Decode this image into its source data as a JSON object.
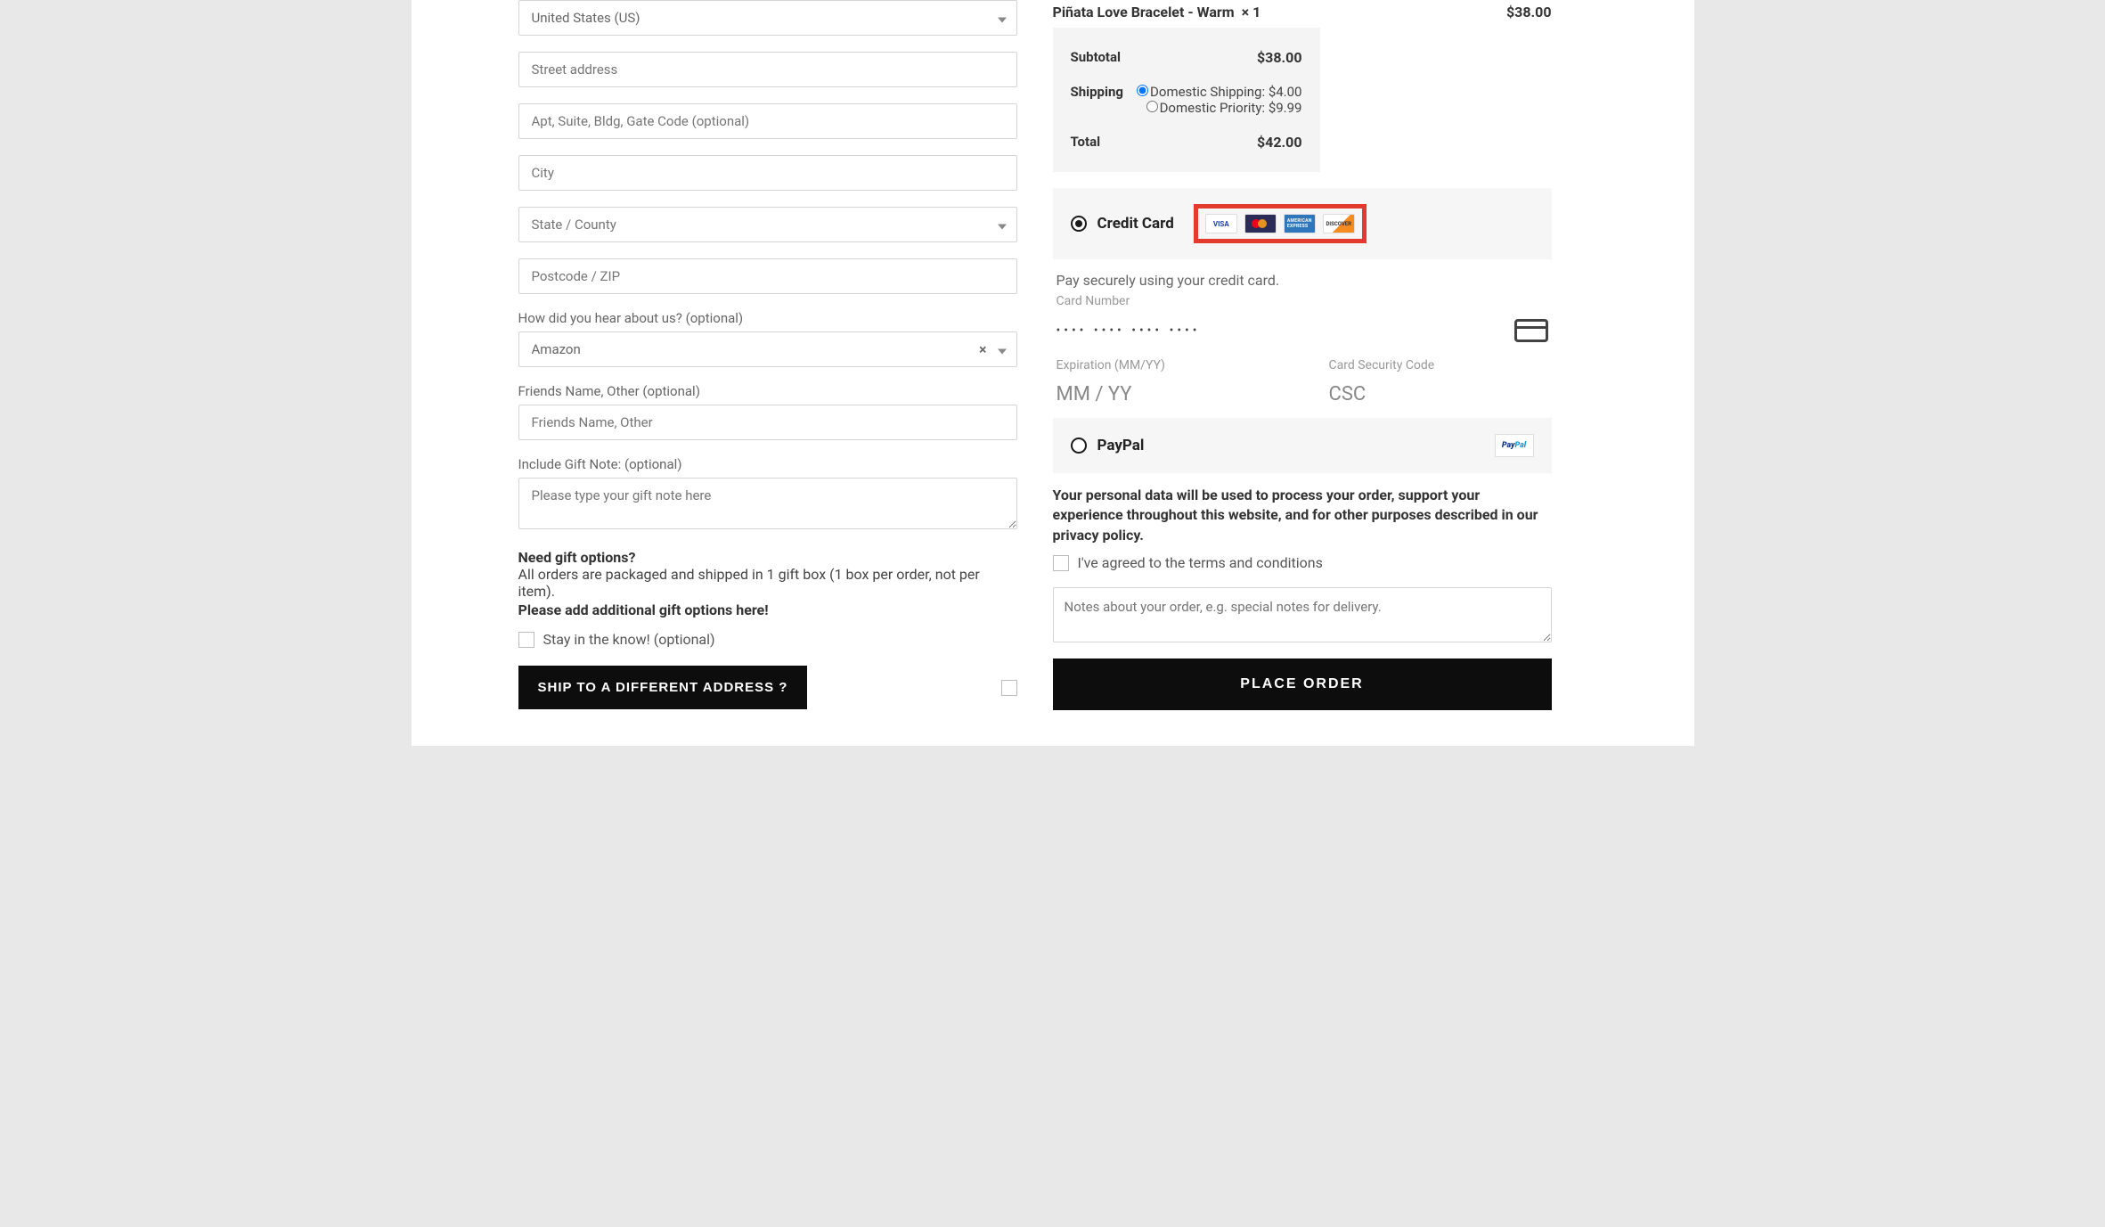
{
  "billing": {
    "country_value": "United States (US)",
    "street_placeholder": "Street address",
    "apt_placeholder": "Apt, Suite, Bldg, Gate Code (optional)",
    "city_placeholder": "City",
    "state_placeholder": "State / County",
    "postcode_placeholder": "Postcode / ZIP",
    "hear_label": "How did you hear about us? (optional)",
    "hear_value": "Amazon",
    "friends_label": "Friends Name, Other (optional)",
    "friends_placeholder": "Friends Name, Other",
    "gift_label": "Include Gift Note: (optional)",
    "gift_placeholder": "Please type your gift note here",
    "gift_heading": "Need gift options?",
    "gift_text": "All orders are packaged and shipped in 1 gift box (1 box per order, not per item).",
    "gift_bold": "Please add additional gift options here!",
    "newsletter_label": "Stay in the know! (optional)",
    "ship_button": "SHIP TO A DIFFERENT ADDRESS ?"
  },
  "order": {
    "product_name": "Piñata Love Bracelet - Warm",
    "product_qty": "× 1",
    "product_price": "$38.00",
    "subtotal_label": "Subtotal",
    "subtotal": "$38.00",
    "shipping_label": "Shipping",
    "shipping_opts": [
      {
        "label": "Domestic Shipping:",
        "price": "$4.00",
        "selected": true
      },
      {
        "label": "Domestic Priority:",
        "price": "$9.99",
        "selected": false
      }
    ],
    "total_label": "Total",
    "total": "$42.00"
  },
  "payment": {
    "credit_card_label": "Credit Card",
    "card_brands": [
      "VISA",
      "mastercard",
      "AMEX",
      "DISCOVER"
    ],
    "secure_text": "Pay securely using your credit card.",
    "card_number_label": "Card Number",
    "card_dots": "•••• •••• •••• ••••",
    "exp_label": "Expiration (MM/YY)",
    "exp_placeholder": "MM / YY",
    "csc_label": "Card Security Code",
    "csc_placeholder": "CSC",
    "paypal_label": "PayPal"
  },
  "footer": {
    "policy": "Your personal data will be used to process your order, support your experience throughout this website, and for other purposes described in our privacy policy.",
    "terms_label": "I've agreed to the terms and conditions",
    "notes_placeholder": "Notes about your order, e.g. special notes for delivery.",
    "place_order": "PLACE ORDER"
  }
}
